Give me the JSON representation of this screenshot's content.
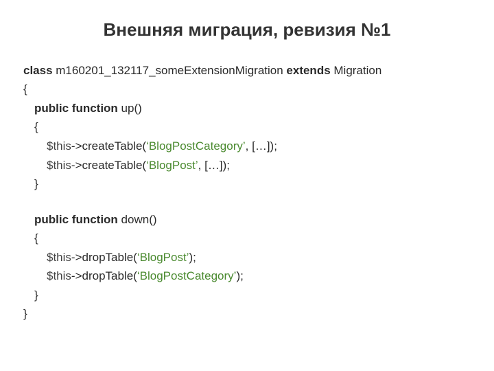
{
  "title": "Внешняя миграция, ревизия №1",
  "code": {
    "kw_class": "class",
    "class_name": " m160201_132117_someExtensionMigration ",
    "kw_extends": "extends",
    "extends_name": " Migration",
    "brace_open": "{",
    "brace_close": "}",
    "kw_public_function1": "public function",
    "fn_up": " up()",
    "kw_public_function2": "public function",
    "fn_down": " down()",
    "this": "$this",
    "arrow_createTable_open": "->createTable(",
    "arrow_dropTable_open": "->dropTable(",
    "str_q_open": "‘",
    "str_q_close": "’",
    "name_BlogPostCategory": "BlogPostCategory",
    "name_BlogPost": "BlogPost",
    "after_create_args": ", […]);",
    "after_drop_close": ");"
  }
}
